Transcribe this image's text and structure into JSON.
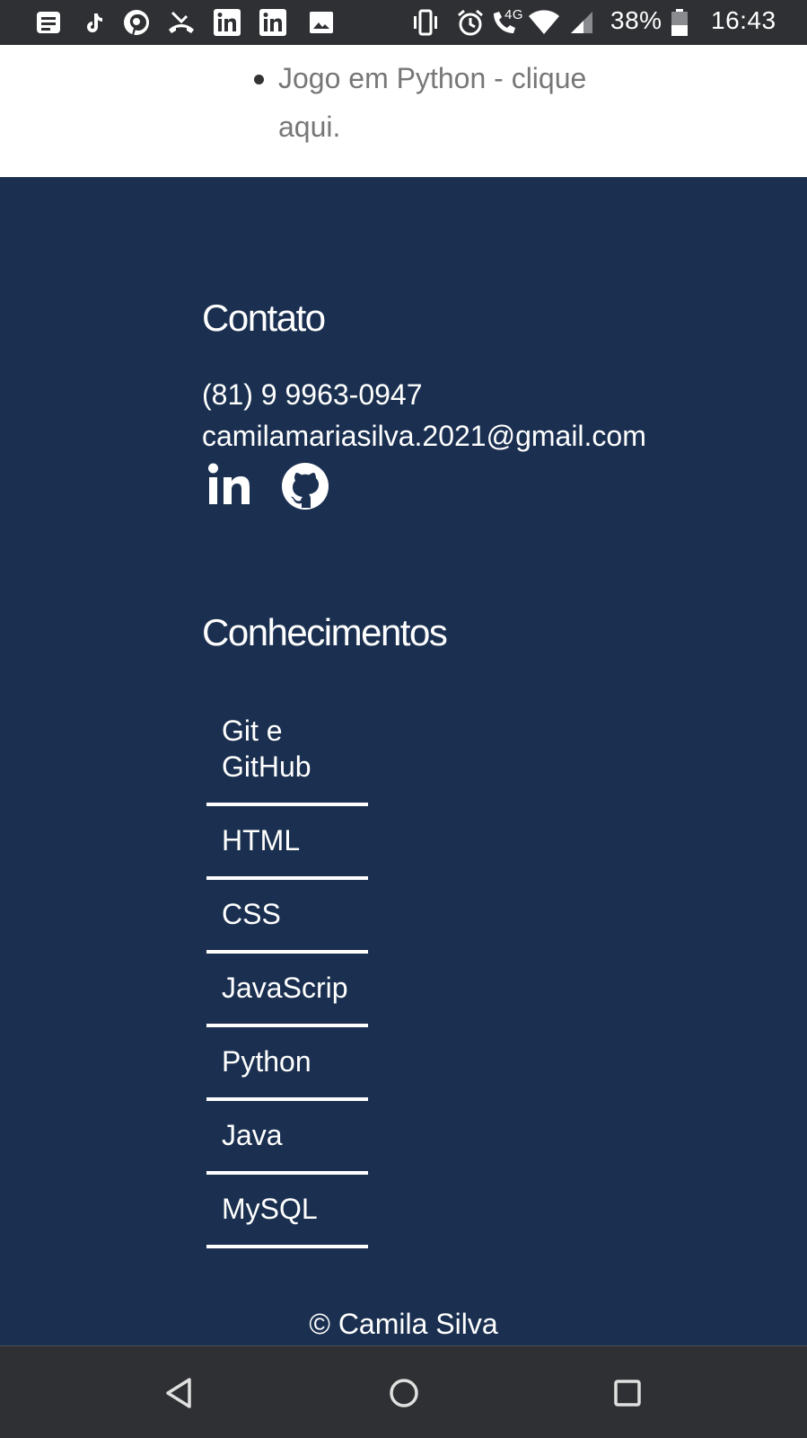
{
  "status_bar": {
    "battery": "38%",
    "time": "16:43",
    "network": "4G",
    "icons": [
      "notes-icon",
      "tiktok-icon",
      "pinterest-icon",
      "missed-call-icon",
      "linkedin-icon",
      "linkedin-icon",
      "image-icon",
      "vibrate-icon",
      "alarm-icon",
      "volte-call-icon",
      "wifi-icon",
      "signal-icon",
      "battery-icon"
    ]
  },
  "projects": {
    "item_text": "Jogo em Python - clique aqui."
  },
  "contact": {
    "heading": "Contato",
    "phone": "(81) 9 9963-0947",
    "email": "camilamariasilva.2021@gmail.com",
    "social": [
      "linkedin-icon",
      "github-icon"
    ]
  },
  "skills": {
    "heading": "Conhecimentos",
    "items": [
      "Git e GitHub",
      "HTML",
      "CSS",
      "JavaScrip",
      "Python",
      "Java",
      "MySQL"
    ]
  },
  "footer": {
    "copyright": "© Camila Silva"
  },
  "colors": {
    "footer_bg": "#1b3050",
    "system_bars": "#2f3033",
    "text_light": "#ffffff"
  },
  "nav_bar": {
    "buttons": [
      "back-icon",
      "home-icon",
      "recents-icon"
    ]
  }
}
